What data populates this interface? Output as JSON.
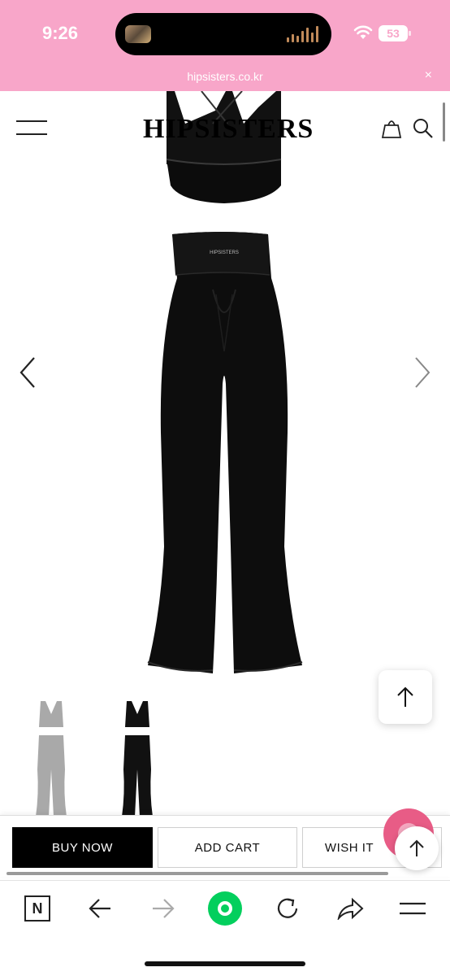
{
  "status_bar": {
    "time": "9:26",
    "battery": "53",
    "url": "hipsisters.co.kr",
    "close": "×",
    "background_color": "#f8a6c9"
  },
  "header": {
    "logo": "HIPSISTERS",
    "menu_icon": "hamburger-menu-icon",
    "cart_icon": "shopping-bag-icon",
    "search_icon": "search-icon"
  },
  "gallery": {
    "prev_icon": "chevron-left-icon",
    "next_icon": "chevron-right-icon",
    "waistband_text": "HIPSISTERS",
    "thumbnails": [
      {
        "name": "gray-set",
        "color": "#a9a9a9"
      },
      {
        "name": "black-set",
        "color": "#111111"
      }
    ]
  },
  "floating": {
    "scroll_top_icon": "arrow-up-icon"
  },
  "purchase": {
    "buy_now": "BUY NOW",
    "add_cart": "ADD CART",
    "wish_it": "WISH IT"
  },
  "browser_toolbar": {
    "n_label": "N",
    "items": [
      "n-icon",
      "back-arrow-icon",
      "forward-arrow-icon",
      "green-dot-icon",
      "reload-icon",
      "share-icon",
      "menu-icon"
    ],
    "accent_color": "#03cf5d"
  }
}
